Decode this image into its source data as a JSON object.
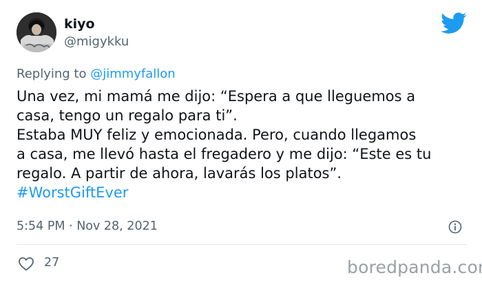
{
  "author": {
    "name": "kiyo",
    "handle": "@migykku",
    "avatar_icon": "profile-photo"
  },
  "platform_icon": "twitter-bird-icon",
  "reply": {
    "prefix": "Replying to ",
    "mention": "@jimmyfallon"
  },
  "tweet": {
    "lines": [
      "Una vez, mi mamá me dijo: “Espera a que lleguemos a",
      "casa, tengo un regalo para ti”.",
      "Estaba MUY feliz y emocionada. Pero, cuando llegamos",
      "a casa, me llevó hasta el fregadero y me dijo: “Este es tu",
      "regalo. A partir de ahora, lavarás los platos”."
    ],
    "hashtag": "#WorstGiftEver"
  },
  "timestamp": "5:54 PM · Nov 28, 2021",
  "likes": "27",
  "watermark": "boredpanda.com",
  "colors": {
    "text": "#0f1419",
    "muted": "#536471",
    "link": "#1d9bf0",
    "divider": "#e1e8ed"
  }
}
